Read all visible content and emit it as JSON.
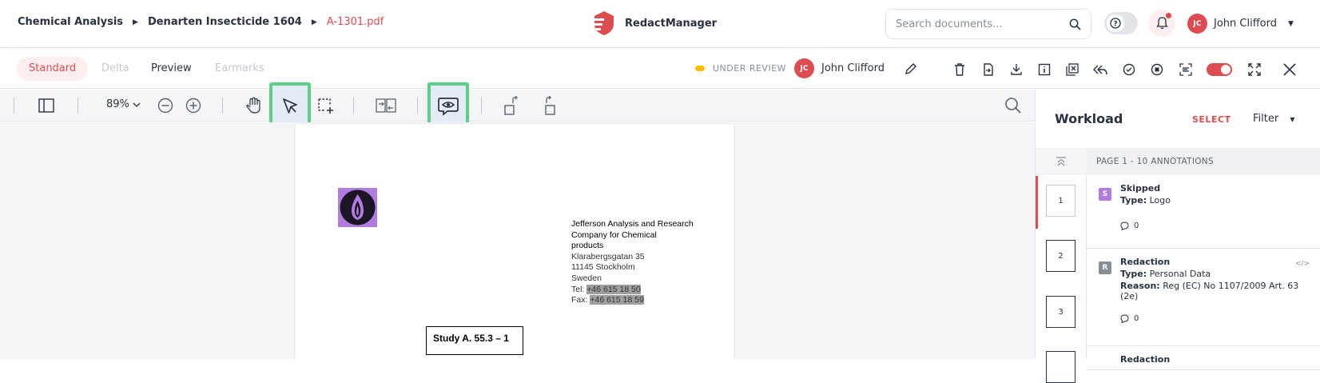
{
  "breadcrumb": {
    "items": [
      "Chemical Analysis",
      "Denarten Insecticide 1604"
    ],
    "current": "A-1301.pdf"
  },
  "app": {
    "name": "RedactManager",
    "brand_color": "#dd4d50"
  },
  "search": {
    "placeholder": "Search documents..."
  },
  "user": {
    "initials": "JC",
    "name": "John Clifford"
  },
  "view_tabs": [
    {
      "label": "Standard",
      "state": "active"
    },
    {
      "label": "Delta",
      "state": "disabled"
    },
    {
      "label": "Preview",
      "state": "normal"
    },
    {
      "label": "Earmarks",
      "state": "disabled"
    }
  ],
  "status": {
    "label": "UNDER REVIEW",
    "color": "#fdbd00"
  },
  "assignee": {
    "initials": "JC",
    "name": "John Clifford"
  },
  "toolbar": {
    "zoom": "89%"
  },
  "document": {
    "address_lines": [
      "Jefferson Analysis and Research",
      "Company for Chemical",
      "products",
      "Klarabergsgatan 35",
      "11145 Stockholm",
      "Sweden"
    ],
    "tel_label": "Tel:",
    "tel_value": "+46 615 18 50",
    "fax_label": "Fax:",
    "fax_value": "+46 615 18 59",
    "study_title": "Study A. 55.3 – 1"
  },
  "workload": {
    "title": "Workload",
    "select_label": "SELECT",
    "filter_label": "Filter",
    "section_header": "PAGE 1 - 10 ANNOTATIONS",
    "pages": [
      "1",
      "2",
      "3"
    ],
    "annotations": [
      {
        "badge": "S",
        "badge_color": "#b17be0",
        "kind": "Skipped",
        "type_label": "Type:",
        "type_value": "Logo",
        "comments": "0"
      },
      {
        "badge": "R",
        "badge_color": "#868e9a",
        "kind": "Redaction",
        "type_label": "Type:",
        "type_value": "Personal Data",
        "reason_label": "Reason:",
        "reason_value": "Reg (EC) No 1107/2009 Art. 63 (2e)",
        "comments": "0"
      },
      {
        "badge": "",
        "badge_color": "#868e9a",
        "kind": "Redaction",
        "type_label": "",
        "type_value": "",
        "comments": ""
      }
    ]
  }
}
